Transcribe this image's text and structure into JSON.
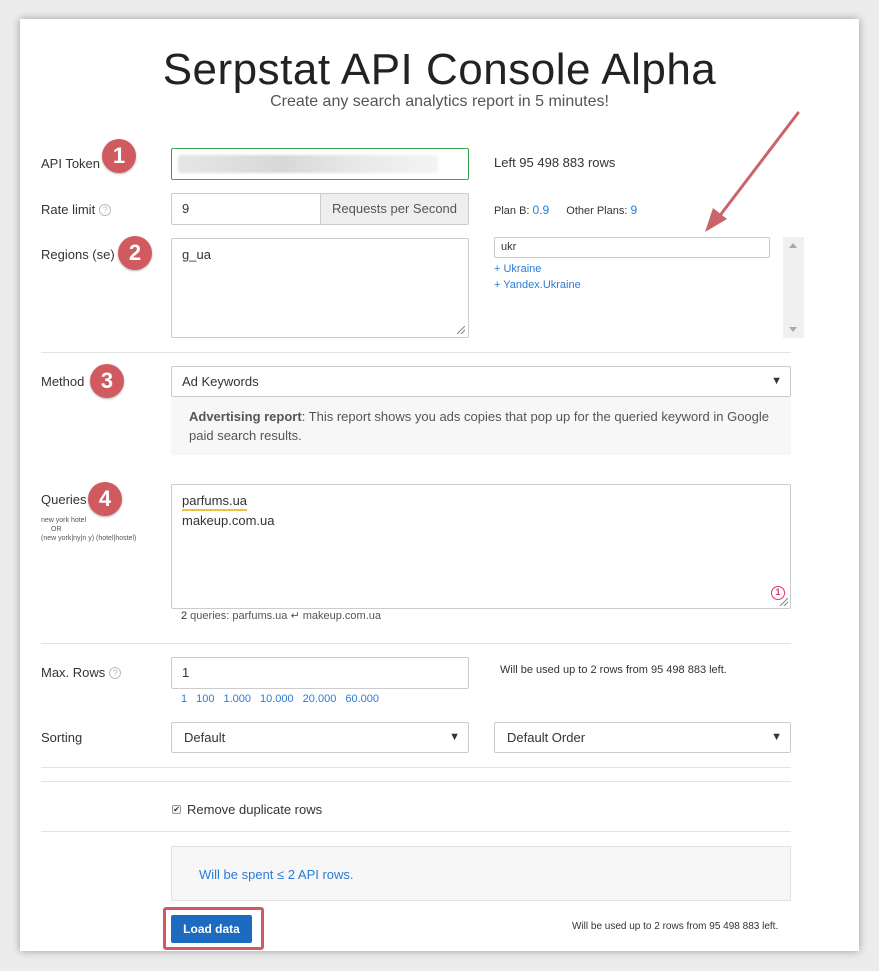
{
  "header": {
    "title": "Serpstat API Console Alpha",
    "subtitle": "Create any search analytics report in 5 minutes!"
  },
  "badges": [
    "1",
    "2",
    "3",
    "4"
  ],
  "api_token": {
    "label": "API Token",
    "value": "",
    "left_text": "Left 95 498 883 rows"
  },
  "rate_limit": {
    "label": "Rate limit",
    "help_icon": "?",
    "value": "9",
    "addon": "Requests per Second",
    "plan_b_label": "Plan B:",
    "plan_b_value": "0.9",
    "other_plans_label": "Other Plans:",
    "other_plans_value": "9"
  },
  "regions": {
    "label": "Regions (se)",
    "value": "g_ua",
    "search_value": "ukr",
    "results": [
      "+ Ukraine",
      "+ Yandex.Ukraine"
    ]
  },
  "method": {
    "label": "Method",
    "selected": "Ad Keywords",
    "desc_bold": "Advertising report",
    "desc_text": ": This report shows you ads copies that pop up for the queried keyword in Google paid search results."
  },
  "queries": {
    "label": "Queries",
    "hint_line1": "new york hotel",
    "hint_line2": "OR",
    "hint_line3": "(new york|ny|n y) (hotel|hostel)",
    "lines": [
      "parfums.ua",
      "makeup.com.ua"
    ],
    "counter": "1",
    "summary_count": "2",
    "summary_text": " queries: parfums.ua ↵ makeup.com.ua"
  },
  "max_rows": {
    "label": "Max. Rows",
    "help_icon": "?",
    "value": "1",
    "presets": [
      "1",
      "100",
      "1.000",
      "10.000",
      "20.000",
      "60.000"
    ],
    "usage_text": "Will be used up to 2 rows from 95 498 883 left."
  },
  "sorting": {
    "label": "Sorting",
    "field": "Default",
    "order": "Default Order"
  },
  "options": {
    "remove_duplicates": "Remove duplicate rows",
    "checkbox_mark": "✔"
  },
  "summary": {
    "spent_text": "Will be spent ≤ 2 API rows."
  },
  "footer": {
    "load_button": "Load data",
    "usage_text": "Will be used up to 2 rows from 95 498 883 left."
  },
  "colors": {
    "accent": "#2a7bd5",
    "badge": "#d05a5f",
    "button": "#1d6bc0",
    "arrow": "#c9656a",
    "token_border": "#3aa54a"
  }
}
